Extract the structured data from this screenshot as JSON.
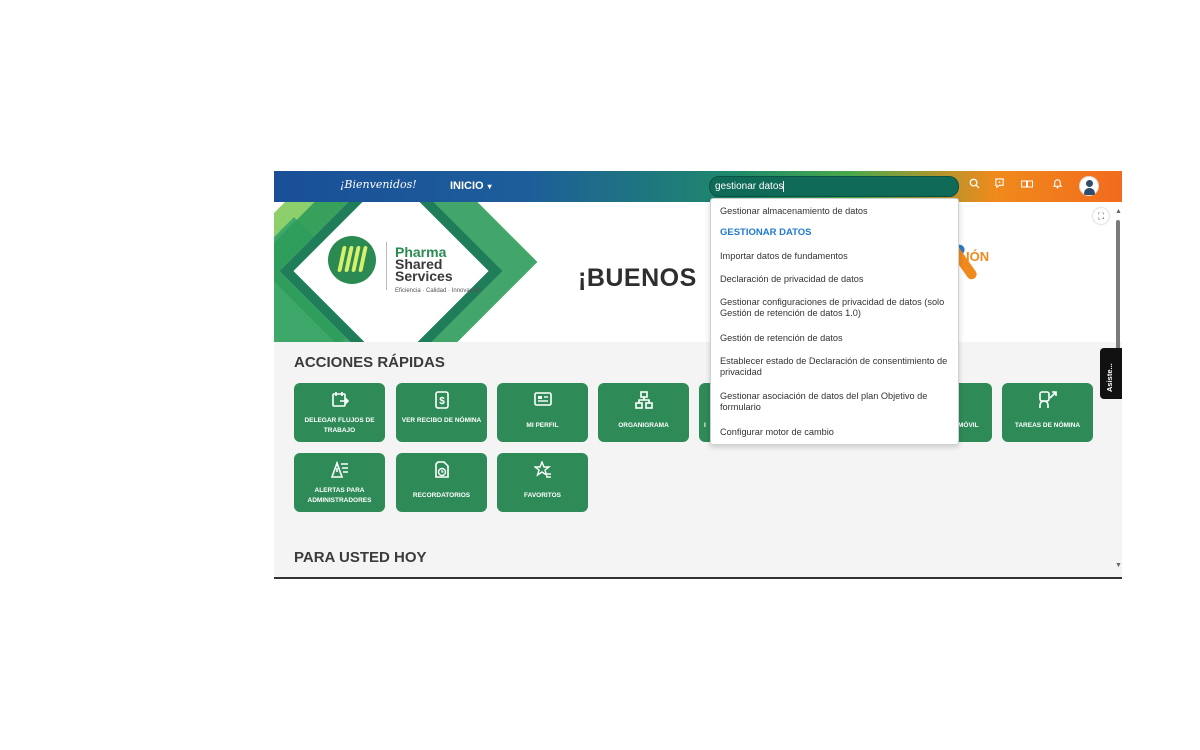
{
  "topbar": {
    "welcome": "¡Bienvenidos!",
    "home_menu": "INICIO",
    "home_chevron": "▾",
    "search_value": "gestionar datos",
    "icons": [
      "search-icon",
      "help-icon",
      "apps-icon",
      "bell-icon",
      "avatar"
    ]
  },
  "banner": {
    "logo_line1": "Pharma",
    "logo_line2": "Shared",
    "logo_line3": "Services",
    "logo_tagline": "Eficiencia · Calidad · Innovación",
    "greeting": "¡BUENOS",
    "right_word": "IÓN"
  },
  "quick_actions": {
    "title": "ACCIONES RÁPIDAS",
    "tiles": [
      {
        "label": "DELEGAR FLUJOS DE TRABAJO",
        "icon": "calendar-forward-icon"
      },
      {
        "label": "VER RECIBO DE NÓMINA",
        "icon": "payslip-icon"
      },
      {
        "label": "MI PERFIL",
        "icon": "id-card-icon"
      },
      {
        "label": "ORGANIGRAMA",
        "icon": "org-chart-icon"
      },
      {
        "label": "MÓVIL",
        "icon": "mobile-icon"
      },
      {
        "label": "TAREAS DE NÓMINA",
        "icon": "payroll-tasks-icon"
      },
      {
        "label": "ALERTAS PARA ADMINISTRADORES",
        "icon": "alert-list-icon"
      },
      {
        "label": "RECORDATORIOS",
        "icon": "reminder-icon"
      },
      {
        "label": "FAVORITOS",
        "icon": "star-list-icon"
      }
    ],
    "partial_left_letter": "I"
  },
  "for_you": {
    "title": "PARA USTED HOY"
  },
  "search_suggestions": [
    "Gestionar almacenamiento de datos",
    "GESTIONAR DATOS",
    "Importar datos de fundamentos",
    "Declaración de privacidad de datos",
    "Gestionar configuraciones de privacidad de datos (solo Gestión de retención de datos 1.0)",
    "Gestión de retención de datos",
    "Establecer estado de Declaración de consentimiento de privacidad",
    "Gestionar asociación de datos del plan Objetivo de formulario",
    "Configurar motor de cambio"
  ],
  "side_tab": {
    "label": "Asiste..."
  },
  "colors": {
    "tile_green": "#2e8b57",
    "active_suggestion": "#1f7ad0"
  }
}
